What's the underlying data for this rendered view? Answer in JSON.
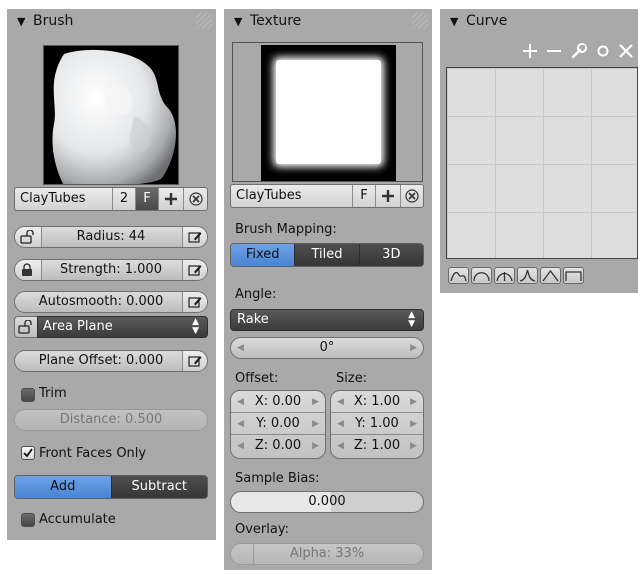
{
  "brush_panel": {
    "title": "Brush",
    "brush_name": "ClayTubes",
    "users": "2",
    "fake_user": "F",
    "radius": "Radius: 44",
    "strength": "Strength: 1.000",
    "autosmooth": "Autosmooth: 0.000",
    "plane_mode": "Area Plane",
    "plane_offset": "Plane Offset: 0.000",
    "trim_label": "Trim",
    "trim_checked": false,
    "distance": "Distance: 0.500",
    "front_faces_label": "Front Faces Only",
    "front_faces_checked": true,
    "direction_options": [
      "Add",
      "Subtract"
    ],
    "direction_selected": "Add",
    "accumulate_label": "Accumulate",
    "accumulate_checked": false
  },
  "texture_panel": {
    "title": "Texture",
    "texture_name": "ClayTubes",
    "fake_user": "F",
    "brush_mapping_label": "Brush Mapping:",
    "mapping_options": [
      "Fixed",
      "Tiled",
      "3D"
    ],
    "mapping_selected": "Fixed",
    "angle_label": "Angle:",
    "angle_mode": "Rake",
    "angle_value": "0°",
    "offset_label": "Offset:",
    "offset": {
      "x": "X: 0.00",
      "y": "Y: 0.00",
      "z": "Z: 0.00"
    },
    "size_label": "Size:",
    "size": {
      "x": "X: 1.00",
      "y": "Y: 1.00",
      "z": "Z: 1.00"
    },
    "sample_bias_label": "Sample Bias:",
    "sample_bias": "0.000",
    "overlay_label": "Overlay:",
    "overlay_alpha": "Alpha: 33%"
  },
  "curve_panel": {
    "title": "Curve",
    "tools": [
      "add-point-icon",
      "remove-point-icon",
      "wrench-icon",
      "dot-icon",
      "close-icon"
    ],
    "presets": [
      "smooth-preset-icon",
      "sphere-preset-icon",
      "root-preset-icon",
      "sharp-preset-icon",
      "line-preset-icon",
      "max-preset-icon"
    ]
  },
  "colors": {
    "panel_bg": "#a9a9a9",
    "selected_blue": "#5a93dd",
    "dark_button": "#404040"
  }
}
